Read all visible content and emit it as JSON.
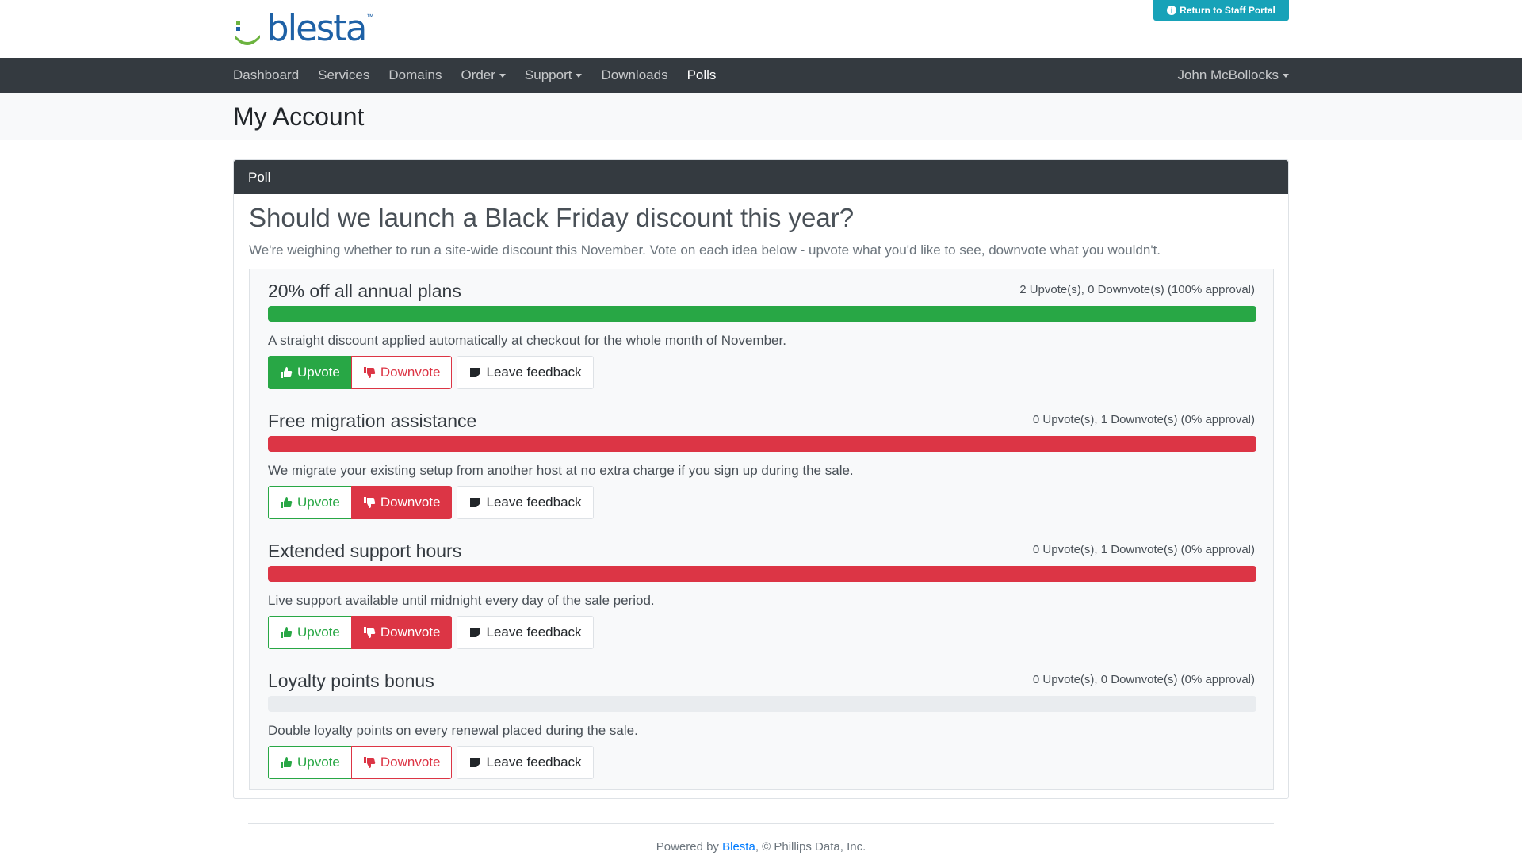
{
  "brand": {
    "logo_text": "blesta",
    "tm": "™"
  },
  "header": {
    "staff_button": "Return to Staff Portal"
  },
  "nav": {
    "items": [
      {
        "label": "Dashboard",
        "dropdown": false,
        "active": false
      },
      {
        "label": "Services",
        "dropdown": false,
        "active": false
      },
      {
        "label": "Domains",
        "dropdown": false,
        "active": false
      },
      {
        "label": "Order",
        "dropdown": true,
        "active": false
      },
      {
        "label": "Support",
        "dropdown": true,
        "active": false
      },
      {
        "label": "Downloads",
        "dropdown": false,
        "active": false
      },
      {
        "label": "Polls",
        "dropdown": false,
        "active": true
      }
    ],
    "user": "John McBollocks"
  },
  "page": {
    "title": "My Account"
  },
  "card": {
    "header": "Poll"
  },
  "poll": {
    "question": "Should we launch a Black Friday discount this year?",
    "description": "We're weighing whether to run a site-wide discount this November. Vote on each idea below - upvote what you'd like to see, downvote what you wouldn't.",
    "buttons": {
      "upvote": "Upvote",
      "downvote": "Downvote",
      "feedback": "Leave feedback"
    },
    "options": [
      {
        "title": "20% off all annual plans",
        "stats": "2 Upvote(s), 0 Downvote(s) (100% approval)",
        "description": "A straight discount applied automatically at checkout for the whole month of November.",
        "bar_fill": 1.0,
        "bar_color": "#28a745",
        "vote": "up"
      },
      {
        "title": "Free migration assistance",
        "stats": "0 Upvote(s), 1 Downvote(s) (0% approval)",
        "description": "We migrate your existing setup from another host at no extra charge if you sign up during the sale.",
        "bar_fill": 1.0,
        "bar_color": "#dc3545",
        "vote": "down"
      },
      {
        "title": "Extended support hours",
        "stats": "0 Upvote(s), 1 Downvote(s) (0% approval)",
        "description": "Live support available until midnight every day of the sale period.",
        "bar_fill": 1.0,
        "bar_color": "#dc3545",
        "vote": "down"
      },
      {
        "title": "Loyalty points bonus",
        "stats": "0 Upvote(s), 0 Downvote(s) (0% approval)",
        "description": "Double loyalty points on every renewal placed during the sale.",
        "bar_fill": 0.0,
        "bar_color": "#e9ecef",
        "vote": "none"
      }
    ]
  },
  "footer": {
    "prefix": "Powered by ",
    "link": "Blesta",
    "suffix": ", © Phillips Data, Inc."
  },
  "colors": {
    "navbar": "#343a40",
    "success": "#28a745",
    "danger": "#dc3545",
    "info": "#17a2b8",
    "brand": "#1e61a6",
    "brand_green": "#6cb33f"
  },
  "icons": {
    "upvote": "thumbs-up-icon",
    "downvote": "thumbs-down-icon",
    "feedback": "sticky-note-icon",
    "staff": "info-circle-icon"
  }
}
